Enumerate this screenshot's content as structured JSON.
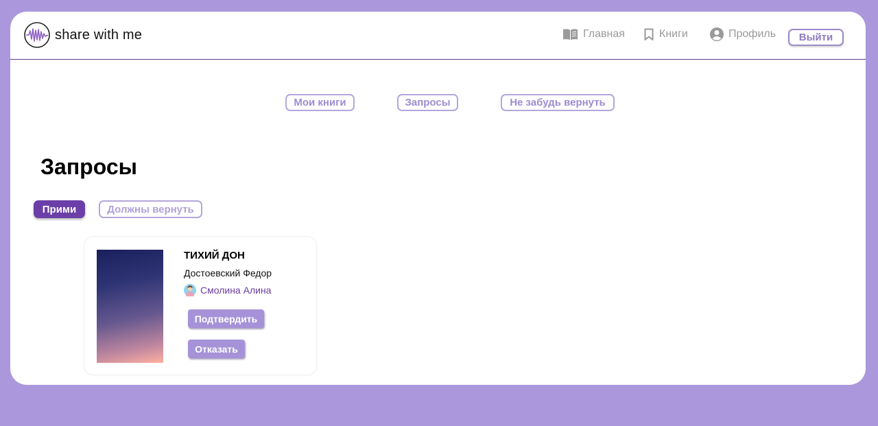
{
  "app": {
    "brand": "share with me"
  },
  "nav": {
    "home": "Главная",
    "books": "Книги",
    "profile": "Профиль",
    "logout": "Выйти"
  },
  "tabs": [
    "Мои книги",
    "Запросы",
    "Не забудь вернуть"
  ],
  "page": {
    "title": "Запросы"
  },
  "chips": {
    "accept": "Прими",
    "return": "Должны вернуть"
  },
  "request": {
    "book_title": "ТИХИЙ ДОН",
    "author": "Достоевский Федор",
    "requester": "Смолина Алина",
    "confirm": "Подтвердить",
    "decline": "Отказать"
  },
  "colors": {
    "background": "#ab98dc",
    "accent": "#6c3fa8",
    "button": "#a592d8",
    "outline": "#b4a6dc"
  },
  "icons": {
    "logo": "soundwave-logo-icon",
    "home": "open-book-icon",
    "books": "bookmark-icon",
    "profile": "user-circle-icon",
    "requester": "avatar-icon"
  }
}
